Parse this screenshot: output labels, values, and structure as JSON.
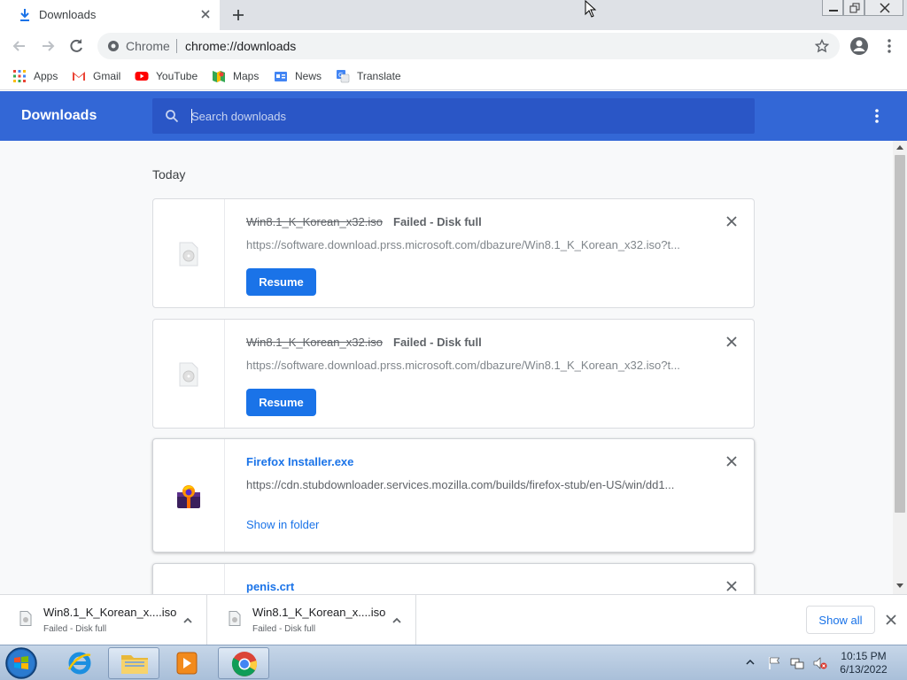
{
  "tab": {
    "title": "Downloads"
  },
  "omnibox": {
    "chip": "Chrome",
    "url": "chrome://downloads"
  },
  "bookmarks": [
    {
      "label": "Apps",
      "icon": "apps-grid-icon"
    },
    {
      "label": "Gmail",
      "icon": "gmail-icon"
    },
    {
      "label": "YouTube",
      "icon": "youtube-icon"
    },
    {
      "label": "Maps",
      "icon": "maps-icon"
    },
    {
      "label": "News",
      "icon": "news-icon"
    },
    {
      "label": "Translate",
      "icon": "translate-icon"
    }
  ],
  "header": {
    "title": "Downloads",
    "search_placeholder": "Search downloads"
  },
  "section": {
    "label": "Today"
  },
  "downloads": [
    {
      "name": "Win8.1_K_Korean_x32.iso",
      "status": "Failed - Disk full",
      "url": "https://software.download.prss.microsoft.com/dbazure/Win8.1_K_Korean_x32.iso?t...",
      "action": "Resume"
    },
    {
      "name": "Win8.1_K_Korean_x32.iso",
      "status": "Failed - Disk full",
      "url": "https://software.download.prss.microsoft.com/dbazure/Win8.1_K_Korean_x32.iso?t...",
      "action": "Resume"
    },
    {
      "name": "Firefox Installer.exe",
      "status": "",
      "url": "https://cdn.stubdownloader.services.mozilla.com/builds/firefox-stub/en-US/win/dd1...",
      "action": "Show in folder"
    },
    {
      "name": "penis.crt",
      "status": "",
      "url": "",
      "action": ""
    }
  ],
  "shelf": {
    "items": [
      {
        "name": "Win8.1_K_Korean_x....iso",
        "status": "Failed - Disk full"
      },
      {
        "name": "Win8.1_K_Korean_x....iso",
        "status": "Failed - Disk full"
      }
    ],
    "show_all": "Show all"
  },
  "clock": {
    "time": "10:15 PM",
    "date": "6/13/2022"
  },
  "colors": {
    "header_blue": "#3367d6",
    "link_blue": "#1a73e8"
  }
}
